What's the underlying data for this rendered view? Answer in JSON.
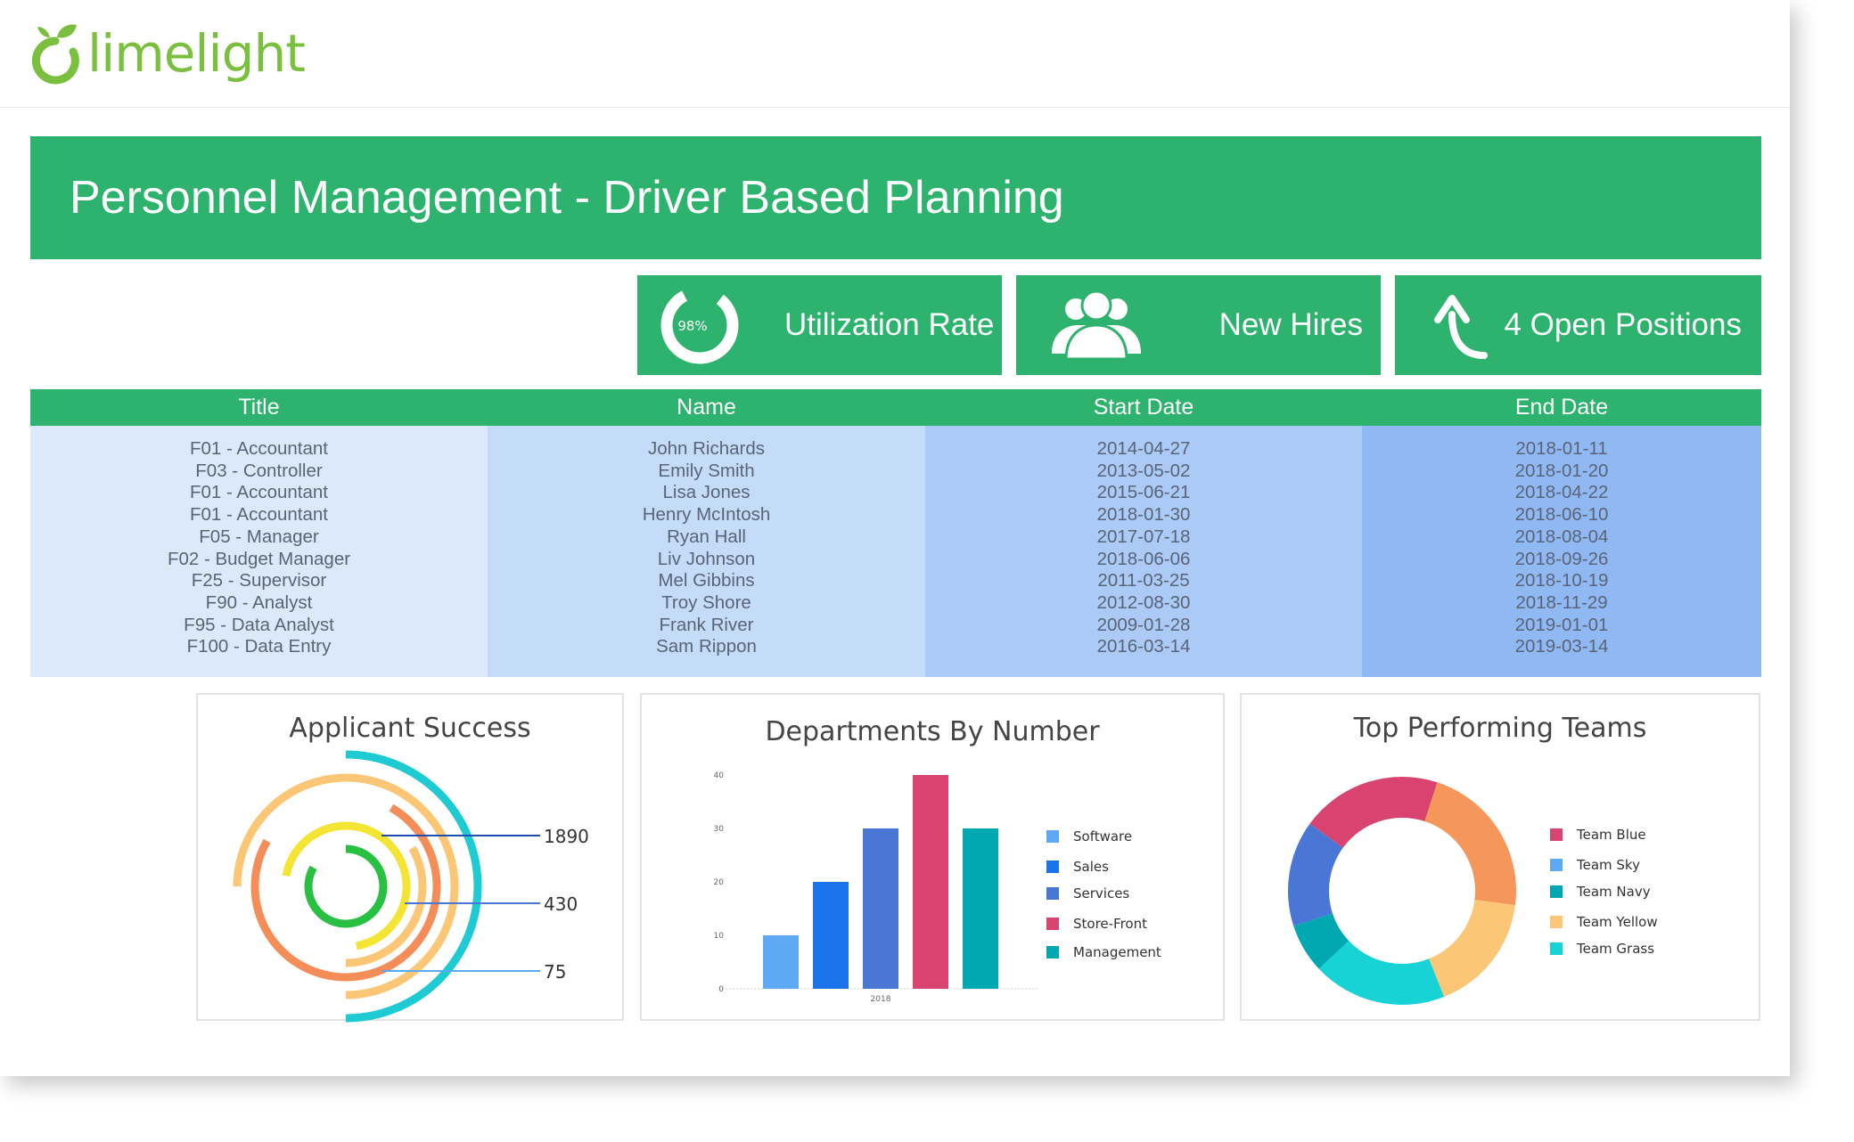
{
  "brand": {
    "logo_text": "limelight",
    "color": "#7bbf3f"
  },
  "banner": {
    "title": "Personnel Management - Driver Based Planning",
    "color": "#2db36d"
  },
  "kpis": {
    "utilization": {
      "label": "Utilization Rate",
      "percent_text": "98%",
      "value": 0.98,
      "icon": "ring-gauge-icon"
    },
    "new_hires": {
      "label": "New Hires",
      "icon": "users-group-icon"
    },
    "open_positions": {
      "label": "4 Open Positions",
      "icon": "arrow-up-curved-icon"
    }
  },
  "table": {
    "headers": [
      "Title",
      "Name",
      "Start Date",
      "End Date"
    ],
    "titles": [
      "F01 - Accountant",
      "F03 - Controller",
      "F01 - Accountant",
      "F01 - Accountant",
      "F05 - Manager",
      "F02 - Budget Manager",
      "F25 - Supervisor",
      "F90 - Analyst",
      "F95 - Data Analyst",
      "F100 - Data Entry"
    ],
    "names": [
      "John Richards",
      "Emily Smith",
      "Lisa Jones",
      "Henry McIntosh",
      "Ryan Hall",
      "Liv Johnson",
      "Mel Gibbins",
      "Troy Shore",
      "Frank River",
      "Sam Rippon"
    ],
    "start_dates": [
      "2014-04-27",
      "2013-05-02",
      "2015-06-21",
      "2018-01-30",
      "2017-07-18",
      "2018-06-06",
      "2011-03-25",
      "2012-08-30",
      "2009-01-28",
      "2016-03-14"
    ],
    "end_dates": [
      "2018-01-11",
      "2018-01-20",
      "2018-04-22",
      "2018-06-10",
      "2018-08-04",
      "2018-09-26",
      "2018-10-19",
      "2018-11-29",
      "2019-01-01",
      "2019-03-14"
    ]
  },
  "chart_data": [
    {
      "type": "radial-bar",
      "title": "Applicant Success",
      "annotations": [
        "1890",
        "430",
        "75"
      ],
      "rings": [
        {
          "color": "#1ecbd2"
        },
        {
          "color": "#fbc776"
        },
        {
          "color": "#f58d59"
        },
        {
          "color": "#fbc776"
        },
        {
          "color": "#f4e433"
        },
        {
          "color": "#28c040"
        }
      ]
    },
    {
      "type": "bar",
      "title": "Departments By Number",
      "categories": [
        "2018"
      ],
      "ylim": [
        0,
        40
      ],
      "yticks": [
        "0",
        "10",
        "20",
        "30",
        "40"
      ],
      "series": [
        {
          "name": "Software",
          "values": [
            10
          ],
          "color": "#5ea9f6"
        },
        {
          "name": "Sales",
          "values": [
            20
          ],
          "color": "#1a73e8"
        },
        {
          "name": "Services",
          "values": [
            30
          ],
          "color": "#4a76d6"
        },
        {
          "name": "Store-Front",
          "values": [
            40
          ],
          "color": "#d9436f"
        },
        {
          "name": "Management",
          "values": [
            30
          ],
          "color": "#00a9b2"
        }
      ],
      "legend": "right"
    },
    {
      "type": "pie",
      "title": "Top Performing Teams",
      "series": [
        {
          "name": "Team Blue",
          "value": 20,
          "color": "#d9436f"
        },
        {
          "name": "Team Sky",
          "value": 22,
          "color": "#f5975a"
        },
        {
          "name": "Team Navy",
          "value": 17,
          "color": "#fbc776"
        },
        {
          "name": "Team Yellow",
          "value": 19,
          "color": "#17d3d6"
        },
        {
          "name": "Team Grass",
          "value": 7,
          "color": "#00a9b2"
        },
        {
          "name": "",
          "value": 15,
          "color": "#4a76d6"
        }
      ],
      "legend_order": [
        "Team Blue",
        "Team Sky",
        "Team Navy",
        "Team Yellow",
        "Team Grass"
      ],
      "legend_colors": [
        "#d9436f",
        "#5ea9f6",
        "#00a9b2",
        "#fbc776",
        "#17d3d6"
      ],
      "legend": "right"
    }
  ]
}
